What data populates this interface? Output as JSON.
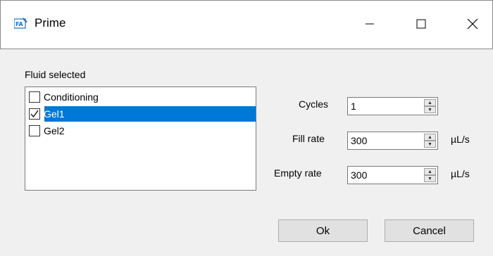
{
  "window": {
    "title": "Prime",
    "icon": "app-fa-icon",
    "controls": {
      "minimize_icon": "minimize-icon",
      "maximize_icon": "maximize-icon",
      "close_icon": "close-icon"
    }
  },
  "fluid": {
    "label": "Fluid selected",
    "items": [
      {
        "label": "Conditioning",
        "checked": false,
        "selected": false
      },
      {
        "label": "Gel1",
        "checked": true,
        "selected": true
      },
      {
        "label": "Gel2",
        "checked": false,
        "selected": false
      }
    ]
  },
  "form": {
    "cycles": {
      "label": "Cycles",
      "value": "1",
      "unit": ""
    },
    "fill_rate": {
      "label": "Fill rate",
      "value": "300",
      "unit": "µL/s"
    },
    "empty_rate": {
      "label": "Empty rate",
      "value": "300",
      "unit": "µL/s"
    }
  },
  "buttons": {
    "ok": "Ok",
    "cancel": "Cancel"
  },
  "colors": {
    "selection": "#0078d7",
    "window_bg": "#f0f0f0"
  }
}
